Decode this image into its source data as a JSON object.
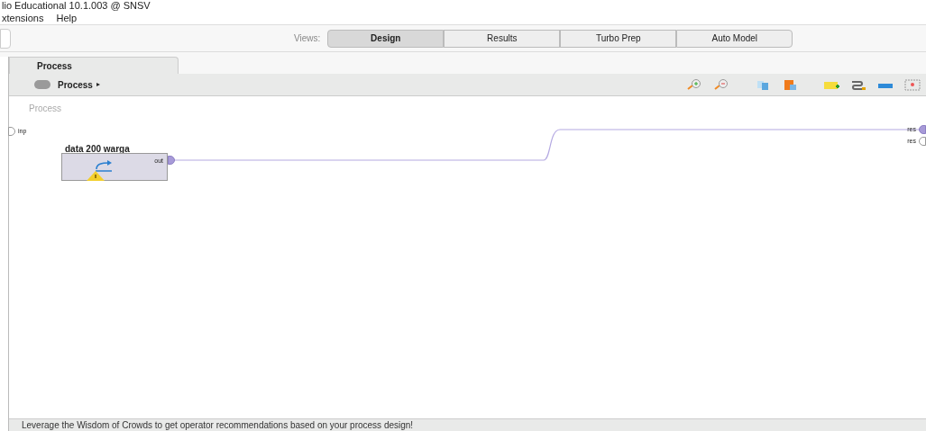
{
  "window": {
    "title": "lio Educational 10.1.003 @ SNSV"
  },
  "menu": [
    "xtensions",
    "Help"
  ],
  "views": {
    "label": "Views:",
    "tabs": [
      {
        "label": "Design",
        "selected": true
      },
      {
        "label": "Results",
        "selected": false
      },
      {
        "label": "Turbo Prep",
        "selected": false
      },
      {
        "label": "Auto Model",
        "selected": false
      }
    ]
  },
  "panel_tab": {
    "label": "Process",
    "selected": true
  },
  "breadcrumb": {
    "label": "Process",
    "arrow": "▸"
  },
  "canvas": {
    "label": "Process",
    "input_ports": [
      {
        "label": "inp",
        "connected": false
      }
    ],
    "output_ports": [
      {
        "label": "res",
        "connected": true
      },
      {
        "label": "res",
        "connected": false
      }
    ],
    "operator": {
      "name": "data 200 warga",
      "port": "out",
      "connected": true,
      "warning": true
    }
  },
  "status_bar": "Leverage the Wisdom of Crowds to get operator recommendations based on your process design!"
}
